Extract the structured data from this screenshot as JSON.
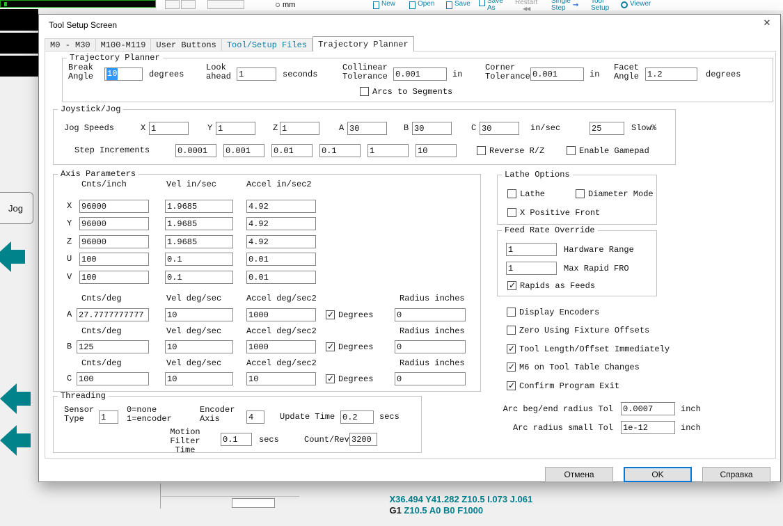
{
  "colors": {
    "accent_teal": "#00838a",
    "toolbar_text": "#0d7fa6",
    "selection_blue": "#3297fd",
    "default_button_border": "#0078d7"
  },
  "background": {
    "units_label": "mm",
    "toolbar_items": [
      {
        "label": "New",
        "icon": "new-file-icon"
      },
      {
        "label": "Open",
        "icon": "open-file-icon"
      },
      {
        "label": "Save",
        "icon": "save-file-icon"
      },
      {
        "label": "Save\nAs",
        "icon": "save-as-icon"
      },
      {
        "label": "Restart",
        "icon": "rewind-icon",
        "glyph": "◀◀"
      },
      {
        "label": "Single\nStep",
        "icon": "single-step-icon"
      },
      {
        "label": "Tool\nSetup",
        "icon": "tool-setup-icon"
      },
      {
        "label": "Viewer",
        "icon": "viewer-icon"
      }
    ],
    "jog_label": "Jog",
    "gcode_line1": "X36.494 Y41.282 Z10.5 I.073 J.061",
    "gcode_line2_prefix": "G1",
    "gcode_line2_rest": "Z10.5 A0 B0 F1000"
  },
  "dialog": {
    "title": "Tool Setup Screen",
    "close_glyph": "✕",
    "tabs": [
      {
        "label": "M0 - M30"
      },
      {
        "label": "M100-M119"
      },
      {
        "label": "User Buttons"
      },
      {
        "label": "Tool/Setup Files"
      },
      {
        "label": "Trajectory Planner"
      }
    ],
    "buttons": {
      "cancel": "Отмена",
      "ok": "OK",
      "help": "Справка"
    }
  },
  "trajectory": {
    "title": "Trajectory Planner",
    "break_label": "Break\nAngle",
    "break_value": "10",
    "break_unit": "degrees",
    "look_label": "Look\nahead",
    "look_value": "1",
    "look_unit": "seconds",
    "collinear_label": "Collinear\nTolerance",
    "collinear_value": "0.001",
    "collinear_unit": "in",
    "corner_label": "Corner\nTolerance",
    "corner_value": "0.001",
    "corner_unit": "in",
    "facet_label": "Facet\nAngle",
    "facet_value": "1.2",
    "facet_unit": "degrees",
    "arcs_label": "Arcs to Segments",
    "arcs_checked": false
  },
  "joystick": {
    "title": "Joystick/Jog",
    "jog_speeds_label": "Jog Speeds",
    "speeds": [
      {
        "axis": "X",
        "value": "1"
      },
      {
        "axis": "Y",
        "value": "1"
      },
      {
        "axis": "Z",
        "value": "1"
      },
      {
        "axis": "A",
        "value": "30"
      },
      {
        "axis": "B",
        "value": "30"
      },
      {
        "axis": "C",
        "value": "30"
      }
    ],
    "speed_unit": "in/sec",
    "slow_value": "25",
    "slow_label": "Slow%",
    "step_label": "Step Increments",
    "steps": [
      "0.0001",
      "0.001",
      "0.01",
      "0.1",
      "1",
      "10"
    ],
    "reverse_label": "Reverse R/Z",
    "reverse_checked": false,
    "gamepad_label": "Enable Gamepad",
    "gamepad_checked": false
  },
  "axis": {
    "title": "Axis Parameters",
    "linear_headers": [
      "Cnts/inch",
      "Vel in/sec",
      "Accel in/sec2"
    ],
    "linear_rows": [
      {
        "axis": "X",
        "cnts": "96000",
        "vel": "1.9685",
        "accel": "4.92"
      },
      {
        "axis": "Y",
        "cnts": "96000",
        "vel": "1.9685",
        "accel": "4.92"
      },
      {
        "axis": "Z",
        "cnts": "96000",
        "vel": "1.9685",
        "accel": "4.92"
      },
      {
        "axis": "U",
        "cnts": "100",
        "vel": "0.1",
        "accel": "0.01"
      },
      {
        "axis": "V",
        "cnts": "100",
        "vel": "0.1",
        "accel": "0.01"
      }
    ],
    "rotary_headers": [
      "Cnts/deg",
      "Vel deg/sec",
      "Accel deg/sec2",
      "Radius inches"
    ],
    "degrees_label": "Degrees",
    "rotary_rows": [
      {
        "axis": "A",
        "cnts": "27.7777777777",
        "vel": "10",
        "accel": "1000",
        "degrees_checked": true,
        "radius": "0"
      },
      {
        "axis": "B",
        "cnts": "125",
        "vel": "10",
        "accel": "1000",
        "degrees_checked": true,
        "radius": "0"
      },
      {
        "axis": "C",
        "cnts": "100",
        "vel": "10",
        "accel": "10",
        "degrees_checked": true,
        "radius": "0"
      }
    ]
  },
  "threading": {
    "title": "Threading",
    "sensor_label": "Sensor\nType",
    "sensor_value": "1",
    "sensor_hint": "0=none\n1=encoder",
    "encoder_label": "Encoder\nAxis",
    "encoder_value": "4",
    "update_label": "Update Time",
    "update_value": "0.2",
    "update_unit": "secs",
    "filter_label": "Motion Filter\nTime",
    "filter_value": "0.1",
    "filter_unit": "secs",
    "countrev_label": "Count/Rev",
    "countrev_value": "3200"
  },
  "lathe": {
    "title": "Lathe Options",
    "lathe_label": "Lathe",
    "lathe_checked": false,
    "diameter_label": "Diameter Mode",
    "diameter_checked": false,
    "xpos_label": "X Positive Front",
    "xpos_checked": false
  },
  "fro": {
    "title": "Feed Rate Override",
    "hardware_value": "1",
    "hardware_label": "Hardware Range",
    "maxrapid_value": "1",
    "maxrapid_label": "Max Rapid FRO",
    "rapids_label": "Rapids as Feeds",
    "rapids_checked": true
  },
  "options": {
    "items": [
      {
        "label": "Display Encoders",
        "checked": false
      },
      {
        "label": "Zero Using Fixture Offsets",
        "checked": false
      },
      {
        "label": "Tool Length/Offset Immediately",
        "checked": true
      },
      {
        "label": "M6 on Tool Table Changes",
        "checked": true
      },
      {
        "label": "Confirm Program Exit",
        "checked": true
      }
    ]
  },
  "arc": {
    "beg_label": "Arc beg/end radius Tol",
    "beg_value": "0.0007",
    "beg_unit": "inch",
    "small_label": "Arc radius small Tol",
    "small_value": "1e-12",
    "small_unit": "inch"
  }
}
